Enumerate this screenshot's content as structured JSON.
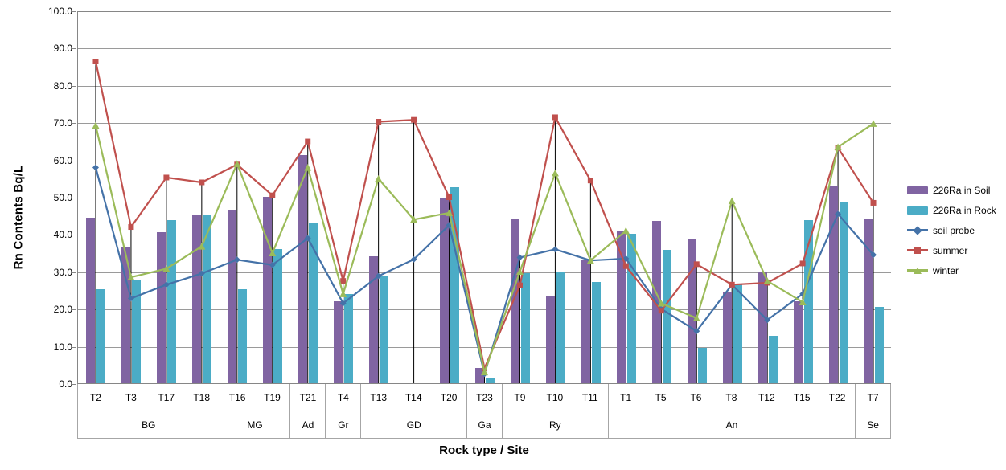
{
  "chart_data": {
    "type": "bar",
    "title": "",
    "xlabel": "Rock type / Site",
    "ylabel": "Rn Contents  Bq/L",
    "ylim": [
      0,
      100
    ],
    "ytick_labels": [
      "0.0",
      "10.0",
      "20.0",
      "30.0",
      "40.0",
      "50.0",
      "60.0",
      "70.0",
      "80.0",
      "90.0",
      "100.0"
    ],
    "ytick_values": [
      0,
      10,
      20,
      30,
      40,
      50,
      60,
      70,
      80,
      90,
      100
    ],
    "grid": "horizontal",
    "legend_position": "right",
    "categories": [
      "T2",
      "T3",
      "T17",
      "T18",
      "T16",
      "T19",
      "T21",
      "T4",
      "T13",
      "T14",
      "T20",
      "T23",
      "T9",
      "T10",
      "T11",
      "T1",
      "T5",
      "T6",
      "T8",
      "T12",
      "T15",
      "T22",
      "T7"
    ],
    "groups": [
      {
        "label": "BG",
        "sites": [
          "T2",
          "T3",
          "T17",
          "T18"
        ]
      },
      {
        "label": "MG",
        "sites": [
          "T16",
          "T19"
        ]
      },
      {
        "label": "Ad",
        "sites": [
          "T21"
        ]
      },
      {
        "label": "Gr",
        "sites": [
          "T4"
        ]
      },
      {
        "label": "GD",
        "sites": [
          "T13",
          "T14",
          "T20"
        ]
      },
      {
        "label": "Ga",
        "sites": [
          "T23"
        ]
      },
      {
        "label": "Ry",
        "sites": [
          "T9",
          "T10",
          "T11"
        ]
      },
      {
        "label": "An",
        "sites": [
          "T1",
          "T5",
          "T6",
          "T8",
          "T12",
          "T15",
          "T22"
        ]
      },
      {
        "label": "Se",
        "sites": [
          "T7"
        ]
      }
    ],
    "series": [
      {
        "name": "226Ra in Soil",
        "kind": "bar",
        "color": "#8064a2",
        "values": [
          44.3,
          36.5,
          40.5,
          45.2,
          46.5,
          50.0,
          61.2,
          22.0,
          34.0,
          null,
          49.5,
          4.0,
          44.0,
          23.3,
          33.0,
          40.8,
          43.5,
          38.5,
          24.5,
          30.0,
          22.0,
          53.0,
          44.0
        ]
      },
      {
        "name": "226Ra in Rock",
        "kind": "bar",
        "color": "#4bacc6",
        "values": [
          25.3,
          27.8,
          43.8,
          45.2,
          25.3,
          36.0,
          43.0,
          24.0,
          28.8,
          null,
          52.5,
          1.5,
          29.5,
          29.8,
          27.2,
          40.0,
          35.8,
          9.5,
          26.5,
          12.8,
          43.8,
          48.5,
          20.5
        ]
      },
      {
        "name": "soil probe",
        "kind": "line",
        "color": "#4472a8",
        "marker": "diamond",
        "values": [
          58.0,
          22.8,
          26.5,
          29.5,
          33.2,
          31.8,
          39.0,
          21.5,
          28.8,
          33.3,
          42.5,
          2.5,
          33.8,
          36.0,
          33.0,
          33.5,
          20.0,
          14.0,
          26.5,
          17.0,
          24.0,
          45.5,
          34.5
        ]
      },
      {
        "name": "summer",
        "kind": "line",
        "color": "#c0504d",
        "marker": "square",
        "values": [
          86.5,
          42.0,
          55.3,
          54.0,
          58.8,
          50.5,
          65.0,
          27.5,
          70.3,
          70.8,
          50.0,
          4.0,
          26.3,
          71.5,
          54.5,
          31.5,
          19.5,
          32.0,
          26.5,
          27.0,
          32.2,
          63.3,
          48.5
        ]
      },
      {
        "name": "winter",
        "kind": "line",
        "color": "#9bbb59",
        "marker": "triangle",
        "values": [
          69.3,
          28.5,
          30.8,
          36.8,
          59.0,
          35.0,
          58.0,
          24.0,
          55.0,
          44.0,
          45.8,
          3.0,
          30.0,
          56.5,
          33.0,
          41.0,
          21.5,
          17.5,
          49.0,
          27.5,
          21.8,
          63.5,
          69.8
        ]
      }
    ]
  },
  "legend": {
    "items": [
      {
        "label": "226Ra in Soil"
      },
      {
        "label": "226Ra in Rock"
      },
      {
        "label": "soil probe"
      },
      {
        "label": "summer"
      },
      {
        "label": "winter"
      }
    ]
  },
  "colors": {
    "soil_bar": "#8064a2",
    "rock_bar": "#4bacc6",
    "soil_probe": "#4472a8",
    "summer": "#c0504d",
    "winter": "#9bbb59",
    "gridline": "#9a9a9a",
    "axis": "#868686",
    "dropline": "#000000"
  }
}
